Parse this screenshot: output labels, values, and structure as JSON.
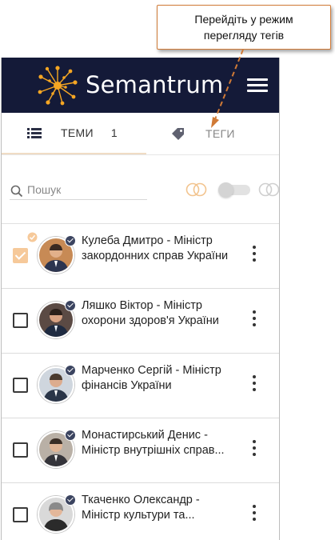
{
  "callout": {
    "text": "Перейдіть у режим перегляду тегів",
    "color": "#d07a36"
  },
  "header": {
    "brand": "Semantrum",
    "logo_icon": "sun-network-logo-icon",
    "menu_icon": "hamburger-menu-icon",
    "background": "#141a38"
  },
  "tabs": {
    "topics": {
      "label": "ТЕМИ",
      "count": "1",
      "icon": "list-icon"
    },
    "tags": {
      "label": "ТЕГИ",
      "icon": "tag-icon"
    }
  },
  "search": {
    "placeholder": "Пошук",
    "icon": "search-icon"
  },
  "filters": {
    "left_icon": "overlap-circles-icon",
    "right_icon": "overlap-circles-icon",
    "toggle_on": false
  },
  "items": [
    {
      "name": "Кулеба Дмитро - Міністр закордонних справ України",
      "checked": true,
      "avatar_color": "#3d4a66"
    },
    {
      "name": "Ляшко Віктор - Міністр охорони здоров'я України",
      "checked": false,
      "avatar_color": "#4a4a50"
    },
    {
      "name": "Марченко Сергій - Міністр фінансів України",
      "checked": false,
      "avatar_color": "#5c6470"
    },
    {
      "name": "Монастирський Денис - Міністр внутрішніх справ...",
      "checked": false,
      "avatar_color": "#8a7e74"
    },
    {
      "name": "Ткаченко Олександр - Міністр культури та...",
      "checked": false,
      "avatar_color": "#9a9a9a"
    }
  ],
  "colors": {
    "accent_orange": "#f6c99a",
    "verified_badge": "#3b4460"
  }
}
